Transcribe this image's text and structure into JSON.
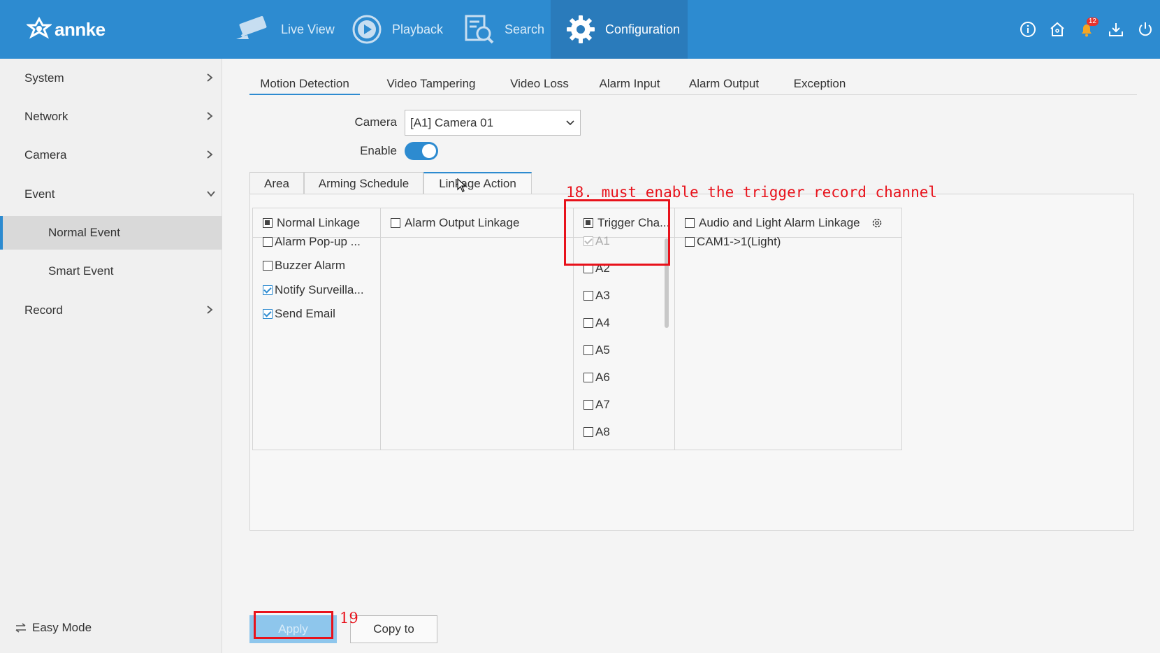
{
  "header": {
    "logo_text": "annke",
    "nav": [
      {
        "label": "Live View",
        "icon": "camera-icon"
      },
      {
        "label": "Playback",
        "icon": "playback-icon"
      },
      {
        "label": "Search",
        "icon": "search-file-icon"
      },
      {
        "label": "Configuration",
        "icon": "gear-icon",
        "active": true
      }
    ],
    "notification_count": "12",
    "icons": [
      "info-icon",
      "home-icon",
      "bell-icon",
      "download-icon",
      "power-icon"
    ]
  },
  "sidebar": {
    "items": [
      {
        "label": "System"
      },
      {
        "label": "Network"
      },
      {
        "label": "Camera"
      },
      {
        "label": "Event"
      },
      {
        "label": "Normal Event",
        "active": true
      },
      {
        "label": "Smart Event"
      },
      {
        "label": "Record"
      }
    ],
    "easy_mode": "Easy Mode"
  },
  "tabs": [
    "Motion Detection",
    "Video Tampering",
    "Video Loss",
    "Alarm Input",
    "Alarm Output",
    "Exception"
  ],
  "form": {
    "camera_label": "Camera",
    "camera_value": "[A1] Camera 01",
    "enable_label": "Enable",
    "enable_on": true
  },
  "subtabs": [
    "Area",
    "Arming Schedule",
    "Linkage Action"
  ],
  "linkage": {
    "normal": {
      "header": "Normal Linkage",
      "items": [
        {
          "label": "Alarm Pop-up ...",
          "checked": false
        },
        {
          "label": "Buzzer Alarm",
          "checked": false
        },
        {
          "label": "Notify Surveilla...",
          "checked": true
        },
        {
          "label": "Send Email",
          "checked": true
        }
      ]
    },
    "alarm_output": {
      "header": "Alarm Output Linkage"
    },
    "trigger": {
      "header": "Trigger Cha...",
      "items": [
        {
          "label": "A1",
          "checked": true,
          "disabled": true
        },
        {
          "label": "A2",
          "checked": false
        },
        {
          "label": "A3",
          "checked": false
        },
        {
          "label": "A4",
          "checked": false
        },
        {
          "label": "A5",
          "checked": false
        },
        {
          "label": "A6",
          "checked": false
        },
        {
          "label": "A7",
          "checked": false
        },
        {
          "label": "A8",
          "checked": false
        }
      ]
    },
    "audio_light": {
      "header": "Audio and Light Alarm Linkage",
      "items": [
        {
          "label": "CAM1->1(Light)",
          "checked": false
        }
      ]
    }
  },
  "annotations": {
    "step18": "18. must enable the trigger record channel",
    "step19": "19"
  },
  "buttons": {
    "apply": "Apply",
    "copy_to": "Copy to"
  },
  "colors": {
    "primary": "#2d8bd0",
    "annotation": "#e8121b"
  }
}
